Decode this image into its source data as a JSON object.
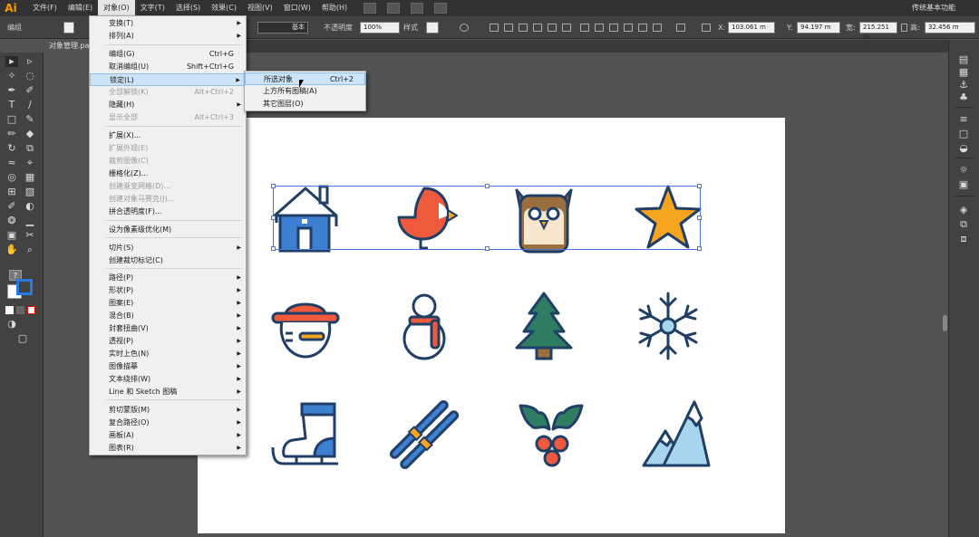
{
  "app": {
    "logo": "Ai",
    "workspace": "传统基本功能"
  },
  "menubar": [
    "文件(F)",
    "编辑(E)",
    "对象(O)",
    "文字(T)",
    "选择(S)",
    "效果(C)",
    "视图(V)",
    "窗口(W)",
    "帮助(H)"
  ],
  "controlbar": {
    "group_label": "编组",
    "stroke_style": "基本",
    "opacity_label": "不透明度",
    "opacity_value": "100%",
    "style_label": "样式",
    "x_label": "X:",
    "x_value": "103.061 m",
    "y_label": "Y:",
    "y_value": "94.197 m",
    "w_label": "宽:",
    "w_value": "215.251 m",
    "h_label": "高:",
    "h_value": "32.456 m"
  },
  "document_tab": "对象管理.pa",
  "object_menu": [
    {
      "label": "变换(T)",
      "shortcut": "",
      "submenu": true,
      "disabled": false
    },
    {
      "label": "排列(A)",
      "shortcut": "",
      "submenu": true,
      "disabled": false
    },
    {
      "label": "编组(G)",
      "shortcut": "Ctrl+G",
      "submenu": false,
      "disabled": false
    },
    {
      "label": "取消编组(U)",
      "shortcut": "Shift+Ctrl+G",
      "submenu": false,
      "disabled": false
    },
    {
      "label": "锁定(L)",
      "shortcut": "",
      "submenu": true,
      "disabled": false,
      "highlighted": true
    },
    {
      "label": "全部解锁(K)",
      "shortcut": "Alt+Ctrl+2",
      "submenu": false,
      "disabled": true
    },
    {
      "label": "隐藏(H)",
      "shortcut": "",
      "submenu": true,
      "disabled": false
    },
    {
      "label": "显示全部",
      "shortcut": "Alt+Ctrl+3",
      "submenu": false,
      "disabled": true
    },
    {
      "label": "扩展(X)...",
      "shortcut": "",
      "submenu": false,
      "disabled": false
    },
    {
      "label": "扩展外观(E)",
      "shortcut": "",
      "submenu": false,
      "disabled": true
    },
    {
      "label": "裁剪图像(C)",
      "shortcut": "",
      "submenu": false,
      "disabled": true
    },
    {
      "label": "栅格化(Z)...",
      "shortcut": "",
      "submenu": false,
      "disabled": false
    },
    {
      "label": "创建渐变网格(D)...",
      "shortcut": "",
      "submenu": false,
      "disabled": true
    },
    {
      "label": "创建对象马赛克(J)...",
      "shortcut": "",
      "submenu": false,
      "disabled": true
    },
    {
      "label": "拼合透明度(F)...",
      "shortcut": "",
      "submenu": false,
      "disabled": false
    },
    {
      "label": "设为像素级优化(M)",
      "shortcut": "",
      "submenu": false,
      "disabled": false
    },
    {
      "label": "切片(S)",
      "shortcut": "",
      "submenu": true,
      "disabled": false
    },
    {
      "label": "创建裁切标记(C)",
      "shortcut": "",
      "submenu": false,
      "disabled": false
    },
    {
      "label": "路径(P)",
      "shortcut": "",
      "submenu": true,
      "disabled": false
    },
    {
      "label": "形状(P)",
      "shortcut": "",
      "submenu": true,
      "disabled": false
    },
    {
      "label": "图案(E)",
      "shortcut": "",
      "submenu": true,
      "disabled": false
    },
    {
      "label": "混合(B)",
      "shortcut": "",
      "submenu": true,
      "disabled": false
    },
    {
      "label": "封套扭曲(V)",
      "shortcut": "",
      "submenu": true,
      "disabled": false
    },
    {
      "label": "透视(P)",
      "shortcut": "",
      "submenu": true,
      "disabled": false
    },
    {
      "label": "实时上色(N)",
      "shortcut": "",
      "submenu": true,
      "disabled": false
    },
    {
      "label": "图像描摹",
      "shortcut": "",
      "submenu": true,
      "disabled": false
    },
    {
      "label": "文本绕排(W)",
      "shortcut": "",
      "submenu": true,
      "disabled": false
    },
    {
      "label": "Line 和 Sketch 图稿",
      "shortcut": "",
      "submenu": true,
      "disabled": false
    },
    {
      "label": "剪切蒙版(M)",
      "shortcut": "",
      "submenu": true,
      "disabled": false
    },
    {
      "label": "复合路径(O)",
      "shortcut": "",
      "submenu": true,
      "disabled": false
    },
    {
      "label": "画板(A)",
      "shortcut": "",
      "submenu": true,
      "disabled": false
    },
    {
      "label": "图表(R)",
      "shortcut": "",
      "submenu": true,
      "disabled": false
    }
  ],
  "lock_submenu": [
    {
      "label": "所选对象",
      "shortcut": "Ctrl+2",
      "highlighted": true
    },
    {
      "label": "上方所有图稿(A)",
      "shortcut": ""
    },
    {
      "label": "其它图层(O)",
      "shortcut": ""
    }
  ],
  "icons": [
    "house-icon",
    "bird-icon",
    "owl-icon",
    "star-icon",
    "hat-face-icon",
    "snowman-icon",
    "pine-tree-icon",
    "snowflake-icon",
    "ice-skate-icon",
    "skis-icon",
    "holly-icon",
    "mountains-icon"
  ],
  "colors": {
    "outline": "#1f3f66",
    "blue": "#3d7fd0",
    "red": "#ef5a3c",
    "orange": "#f7a520",
    "green": "#2e7d62",
    "light_blue": "#a8d5ee",
    "brown": "#9b6e3e"
  }
}
